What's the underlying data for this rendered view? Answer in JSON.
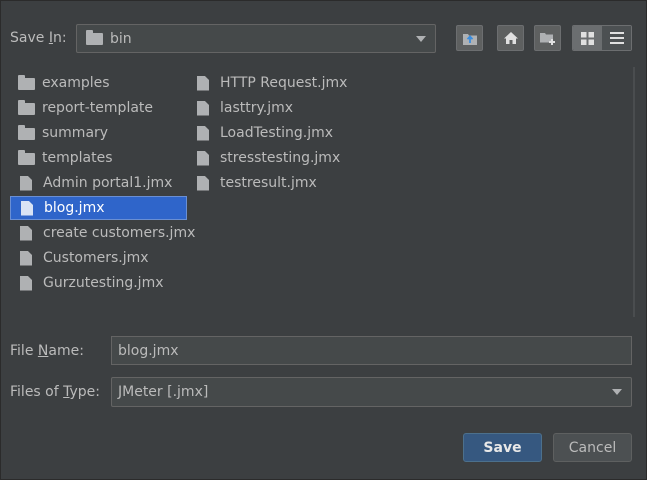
{
  "header": {
    "save_in_prefix": "Save ",
    "save_in_mnemonic": "I",
    "save_in_suffix": "n:",
    "current_folder": "bin"
  },
  "toolbar": {
    "icons": [
      "up-folder-icon",
      "home-icon",
      "new-folder-icon",
      "list-view-icon",
      "details-view-icon"
    ]
  },
  "files": {
    "column1": [
      {
        "name": "examples",
        "kind": "folder"
      },
      {
        "name": "report-template",
        "kind": "folder"
      },
      {
        "name": "summary",
        "kind": "folder"
      },
      {
        "name": "templates",
        "kind": "folder"
      },
      {
        "name": "Admin portal1.jmx",
        "kind": "file"
      },
      {
        "name": "blog.jmx",
        "kind": "file",
        "selected": true
      },
      {
        "name": "create customers.jmx",
        "kind": "file"
      },
      {
        "name": "Customers.jmx",
        "kind": "file"
      },
      {
        "name": "Gurzutesting.jmx",
        "kind": "file"
      }
    ],
    "column2": [
      {
        "name": "HTTP Request.jmx",
        "kind": "file"
      },
      {
        "name": "lasttry.jmx",
        "kind": "file"
      },
      {
        "name": "LoadTesting.jmx",
        "kind": "file"
      },
      {
        "name": "stresstesting.jmx",
        "kind": "file"
      },
      {
        "name": "testresult.jmx",
        "kind": "file"
      }
    ]
  },
  "file_name": {
    "label_prefix": "File ",
    "label_mnemonic": "N",
    "label_suffix": "ame:",
    "value": "blog.jmx"
  },
  "file_type": {
    "label_prefix": "Files of ",
    "label_mnemonic": "T",
    "label_suffix": "ype:",
    "value": "JMeter [.jmx]"
  },
  "buttons": {
    "save": "Save",
    "cancel": "Cancel"
  },
  "colors": {
    "background": "#3c3f41",
    "selection": "#2f65ca",
    "primary_button": "#365880"
  }
}
